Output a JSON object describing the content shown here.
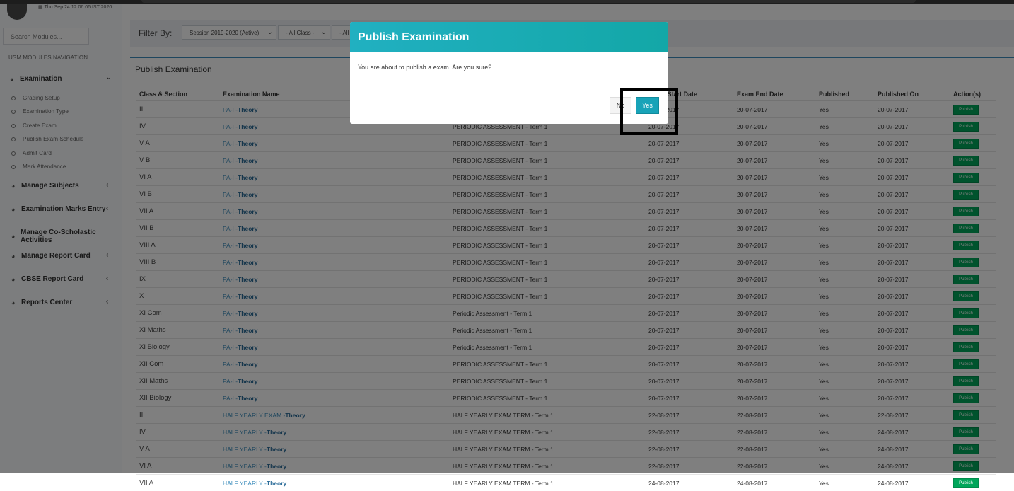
{
  "header": {
    "datetime": "Thu Sep 24 12:06:06 IST 2020"
  },
  "sidebar": {
    "search_placeholder": "Search Modules...",
    "nav_title": "USM MODULES NAVIGATION",
    "examination": {
      "label": "Examination",
      "items": [
        "Grading Setup",
        "Examination Type",
        "Create Exam",
        "Publish Exam Schedule",
        "Admit Card",
        "Mark Attendance"
      ]
    },
    "menus": [
      "Manage Subjects",
      "Examination Marks Entry",
      "Manage Co-Scholastic Activities",
      "Manage Report Card",
      "CBSE Report Card",
      "Reports Center"
    ]
  },
  "filter": {
    "label": "Filter By:",
    "session": "Session 2019-2020 (Active)",
    "class": "- All Class -",
    "third": "- All"
  },
  "main": {
    "title": "Publish Examination"
  },
  "table": {
    "headers": [
      "Class & Section",
      "Examination Name",
      "",
      "Exam Start Date",
      "Exam End Date",
      "Published",
      "Published On",
      "Action(s)"
    ],
    "publish_label": "Publish",
    "rows": [
      [
        "III",
        "PA-I -",
        "Theory",
        "",
        "20-07-2017",
        "20-07-2017",
        "Yes",
        "20-07-2017"
      ],
      [
        "IV",
        "PA-I -",
        "Theory",
        "PERIODIC ASSESSMENT - Term 1",
        "20-07-2017",
        "20-07-2017",
        "Yes",
        "20-07-2017"
      ],
      [
        "V A",
        "PA-I -",
        "Theory",
        "PERIODIC ASSESSMENT - Term 1",
        "20-07-2017",
        "20-07-2017",
        "Yes",
        "20-07-2017"
      ],
      [
        "V B",
        "PA-I -",
        "Theory",
        "PERIODIC ASSESSMENT - Term 1",
        "20-07-2017",
        "20-07-2017",
        "Yes",
        "20-07-2017"
      ],
      [
        "VI A",
        "PA-I -",
        "Theory",
        "PERIODIC ASSESSMENT - Term 1",
        "20-07-2017",
        "20-07-2017",
        "Yes",
        "20-07-2017"
      ],
      [
        "VI B",
        "PA-I -",
        "Theory",
        "PERIODIC ASSESSMENT - Term 1",
        "20-07-2017",
        "20-07-2017",
        "Yes",
        "20-07-2017"
      ],
      [
        "VII A",
        "PA-I -",
        "Theory",
        "PERIODIC ASSESSMENT - Term 1",
        "20-07-2017",
        "20-07-2017",
        "Yes",
        "20-07-2017"
      ],
      [
        "VII B",
        "PA-I -",
        "Theory",
        "PERIODIC ASSESSMENT - Term 1",
        "20-07-2017",
        "20-07-2017",
        "Yes",
        "20-07-2017"
      ],
      [
        "VIII A",
        "PA-I -",
        "Theory",
        "PERIODIC ASSESSMENT - Term 1",
        "20-07-2017",
        "20-07-2017",
        "Yes",
        "20-07-2017"
      ],
      [
        "VIII B",
        "PA-I -",
        "Theory",
        "PERIODIC ASSESSMENT - Term 1",
        "20-07-2017",
        "20-07-2017",
        "Yes",
        "20-07-2017"
      ],
      [
        "IX",
        "PA-I -",
        "Theory",
        "PERIODIC ASSESSMENT - Term 1",
        "20-07-2017",
        "20-07-2017",
        "Yes",
        "20-07-2017"
      ],
      [
        "X",
        "PA-I -",
        "Theory",
        "PERIODIC ASSESSMENT - Term 1",
        "20-07-2017",
        "20-07-2017",
        "Yes",
        "20-07-2017"
      ],
      [
        "XI Com",
        "PA-I -",
        "Theory",
        "Periodic Assessment - Term 1",
        "20-07-2017",
        "20-07-2017",
        "Yes",
        "20-07-2017"
      ],
      [
        "XI Maths",
        "PA-I -",
        "Theory",
        "Periodic Assessment - Term 1",
        "20-07-2017",
        "20-07-2017",
        "Yes",
        "20-07-2017"
      ],
      [
        "XI Biology",
        "PA-I -",
        "Theory",
        "Periodic Assessment - Term 1",
        "20-07-2017",
        "20-07-2017",
        "Yes",
        "20-07-2017"
      ],
      [
        "XII Com",
        "PA-I -",
        "Theory",
        "PERIODIC ASSESSMENT - Term 1",
        "20-07-2017",
        "20-07-2017",
        "Yes",
        "20-07-2017"
      ],
      [
        "XII Maths",
        "PA-I -",
        "Theory",
        "PERIODIC ASSESSMENT - Term 1",
        "20-07-2017",
        "20-07-2017",
        "Yes",
        "20-07-2017"
      ],
      [
        "XII Biology",
        "PA-I -",
        "Theory",
        "PERIODIC ASSESSMENT - Term 1",
        "20-07-2017",
        "20-07-2017",
        "Yes",
        "20-07-2017"
      ],
      [
        "III",
        "HALF YEARLY EXAM -",
        "Theory",
        "HALF YEARLY EXAM TERM - Term 1",
        "22-08-2017",
        "22-08-2017",
        "Yes",
        "22-08-2017"
      ],
      [
        "IV",
        "HALF YEARLY -",
        "Theory",
        "HALF YEARLY EXAM TERM - Term 1",
        "22-08-2017",
        "22-08-2017",
        "Yes",
        "24-08-2017"
      ],
      [
        "V A",
        "HALF YEARLY -",
        "Theory",
        "HALF YEARLY EXAM TERM - Term 1",
        "22-08-2017",
        "22-08-2017",
        "Yes",
        "24-08-2017"
      ],
      [
        "VI A",
        "HALF YEARLY -",
        "Theory",
        "HALF YEARLY EXAM TERM - Term 1",
        "22-08-2017",
        "22-08-2017",
        "Yes",
        "24-08-2017"
      ],
      [
        "VII A",
        "HALF YEARLY -",
        "Theory",
        "HALF YEARLY EXAM TERM - Term 1",
        "24-08-2017",
        "24-08-2017",
        "Yes",
        "24-08-2017"
      ]
    ]
  },
  "modal": {
    "title": "Publish Examination",
    "message": "You are about to publish a exam. Are you sure?",
    "no_label": "No",
    "yes_label": "Yes"
  },
  "colors": {
    "modal_header": "#1aaeb9",
    "yes_button": "#18a3b8",
    "publish_button": "#00a65a",
    "link": "#3c8dbc"
  }
}
